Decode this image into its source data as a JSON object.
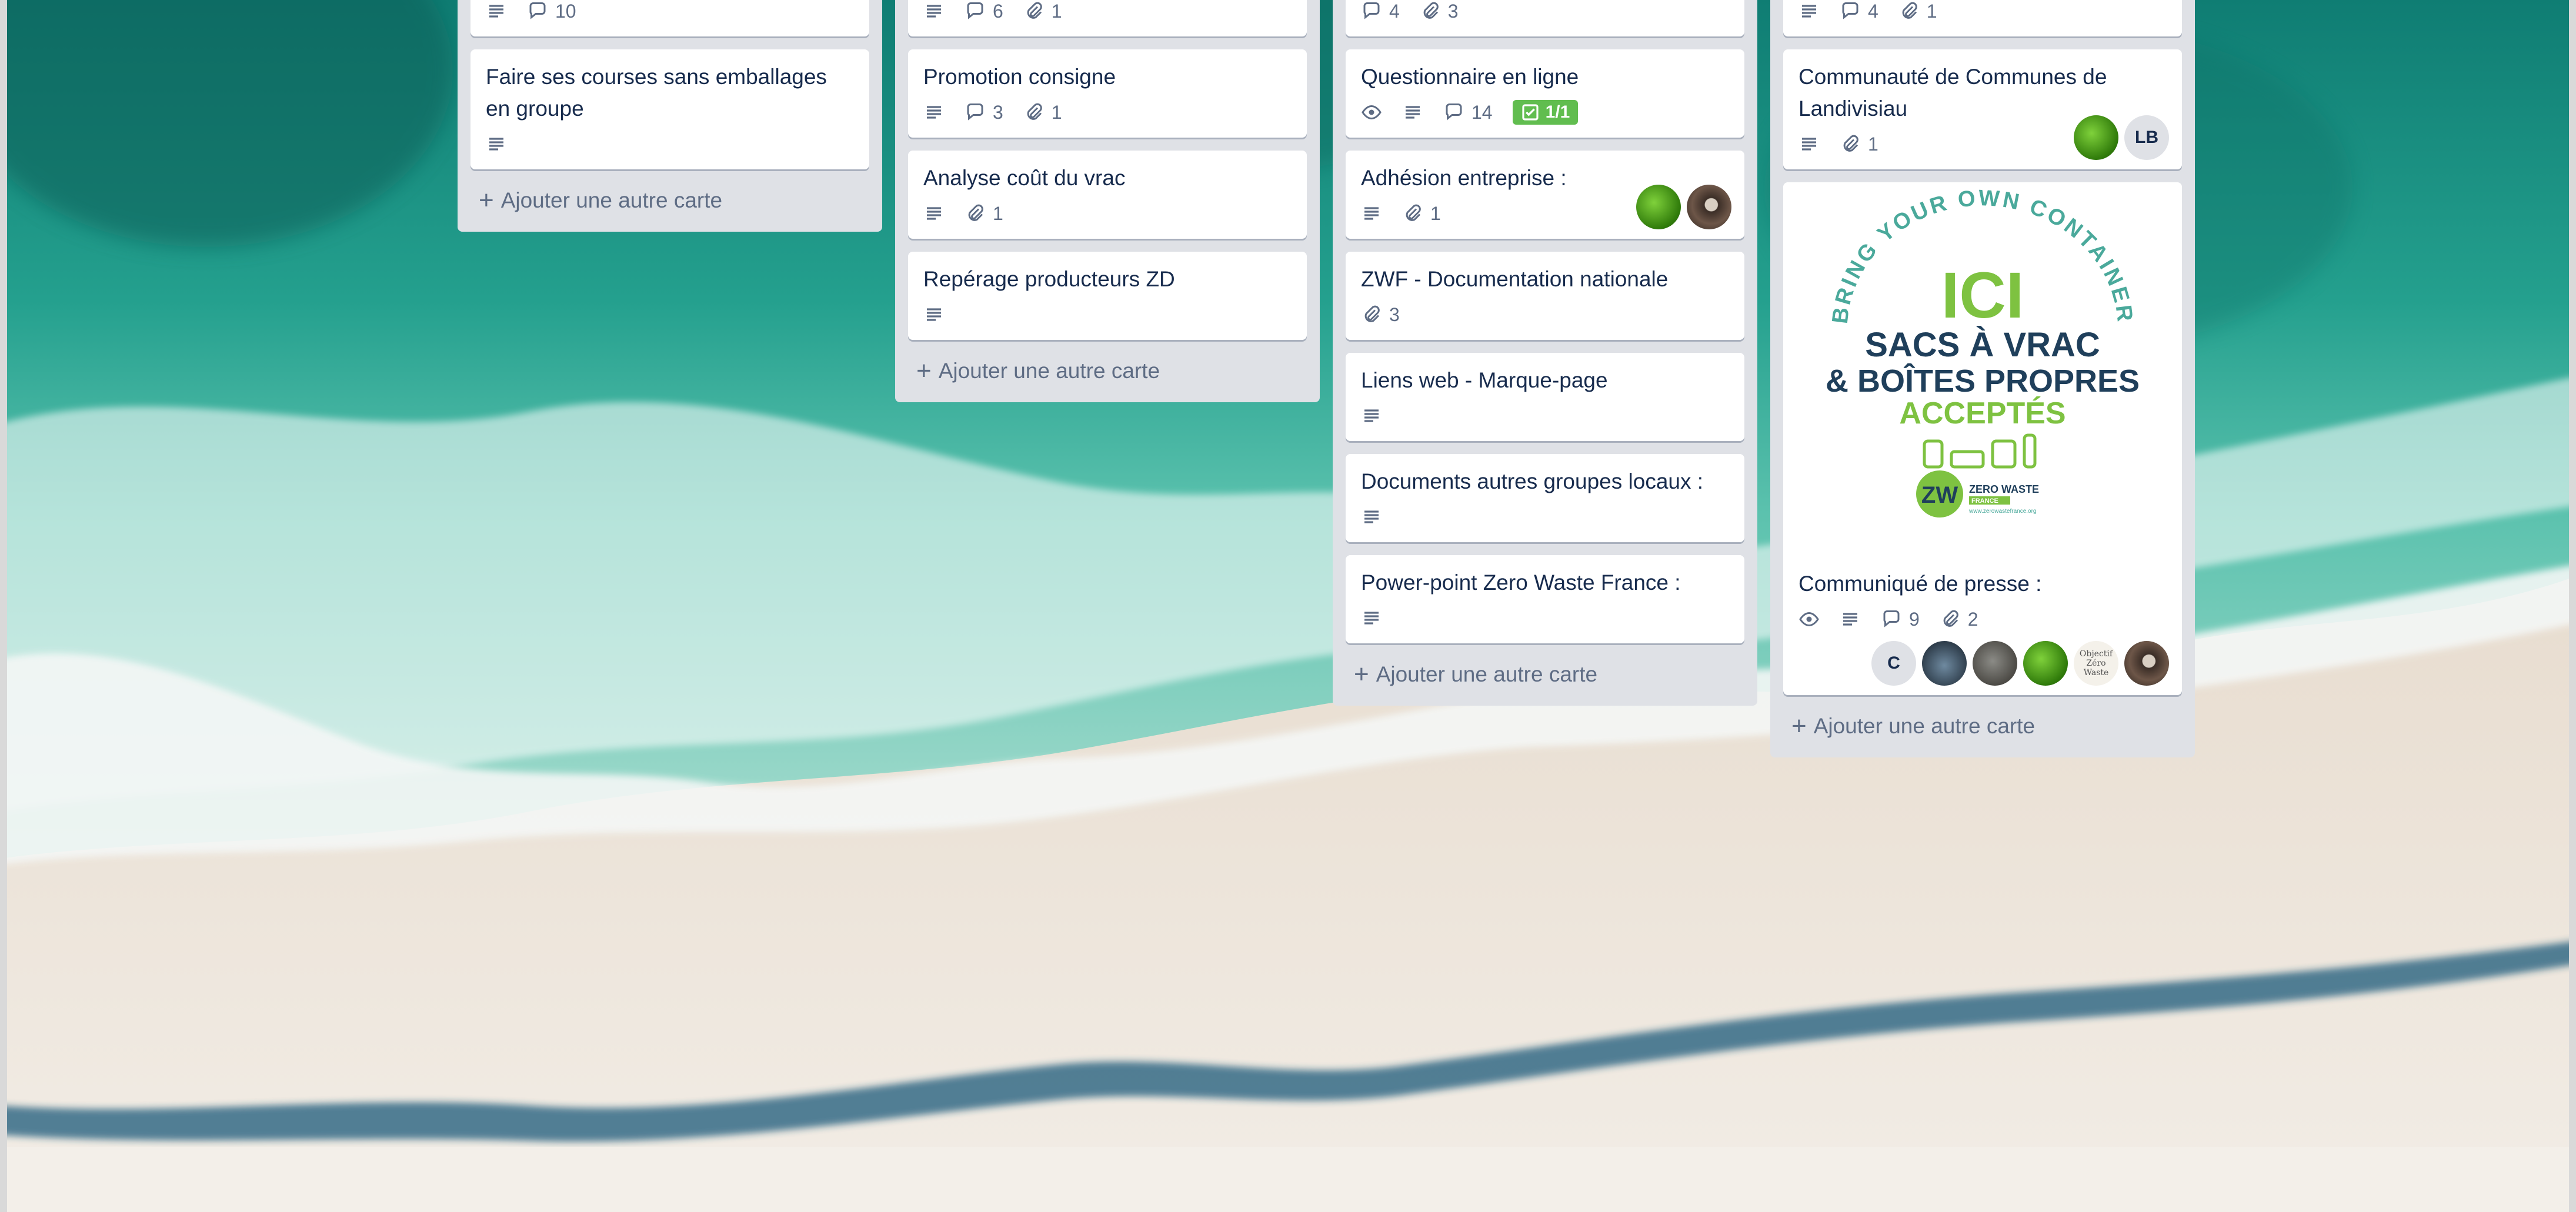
{
  "lists": [
    {
      "id": "list-1",
      "cards": [
        {
          "title": "",
          "badges": {
            "description": true,
            "comments": "10"
          }
        },
        {
          "title": "Faire ses courses sans emballages en groupe",
          "badges": {
            "description": true
          }
        }
      ],
      "add_label": "Ajouter une autre carte"
    },
    {
      "id": "list-2",
      "cards": [
        {
          "title": "",
          "badges": {
            "description": true,
            "comments": "6",
            "attachments": "1"
          }
        },
        {
          "title": "Promotion consigne",
          "badges": {
            "description": true,
            "comments": "3",
            "attachments": "1"
          }
        },
        {
          "title": "Analyse coût du vrac",
          "badges": {
            "description": true,
            "attachments": "1"
          }
        },
        {
          "title": "Repérage producteurs ZD",
          "badges": {
            "description": true
          }
        }
      ],
      "add_label": "Ajouter une autre carte"
    },
    {
      "id": "list-3",
      "cards": [
        {
          "title": "",
          "badges": {
            "comments": "4",
            "attachments": "3"
          }
        },
        {
          "title": "Questionnaire en ligne",
          "badges": {
            "watch": true,
            "description": true,
            "comments": "14",
            "checklist": "1/1"
          }
        },
        {
          "title": "Adhésion entreprise :",
          "badges": {
            "description": true,
            "attachments": "1"
          },
          "members": [
            "green",
            "brown"
          ]
        },
        {
          "title": "ZWF - Documentation nationale",
          "badges": {
            "attachments": "3"
          }
        },
        {
          "title": "Liens web - Marque-page",
          "badges": {
            "description": true
          }
        },
        {
          "title": "Documents autres groupes locaux :",
          "badges": {
            "description": true
          }
        },
        {
          "title": "Power-point Zero Waste France :",
          "badges": {
            "description": true
          }
        }
      ],
      "add_label": "Ajouter une autre carte"
    },
    {
      "id": "list-4",
      "cards": [
        {
          "title": "",
          "badges": {
            "description": true,
            "comments": "4",
            "attachments": "1"
          }
        },
        {
          "title": "Communauté de Communes de Landivisiau",
          "badges": {
            "description": true,
            "attachments": "1"
          },
          "members": [
            "green",
            "LB"
          ]
        },
        {
          "title": "Communiqué de presse :",
          "badges": {
            "watch": true,
            "description": true,
            "comments": "9",
            "attachments": "2"
          },
          "members": [
            "C",
            "blue",
            "dog",
            "green",
            "text",
            "brown"
          ],
          "poster": {
            "arc_text": "BRING YOUR OWN CONTAINER",
            "line1": "ICI",
            "line2": "SACS À VRAC",
            "line3": "& BOÎTES PROPRES",
            "line4": "ACCEPTÉS",
            "logo_text": "ZERO WASTE",
            "logo_sub": "FRANCE",
            "url": "www.zerowastefrance.org"
          }
        }
      ],
      "add_label": "Ajouter une autre carte"
    }
  ],
  "labels": {
    "plus": "+",
    "member_c": "C",
    "member_lb": "LB",
    "member_text_1": "Objectif",
    "member_text_2": "Zéro Waste"
  },
  "colors": {
    "list_bg": "#dfe1e6",
    "card_bg": "#ffffff",
    "checklist_complete": "#61bd4f",
    "text_primary": "#172b4d",
    "text_muted": "#5e6c84",
    "poster_teal": "#4aa99b",
    "poster_navy": "#1f3f5b",
    "poster_green": "#7ec241"
  },
  "icons": [
    "description-icon",
    "comment-icon",
    "attachment-icon",
    "watch-icon",
    "checklist-icon"
  ]
}
